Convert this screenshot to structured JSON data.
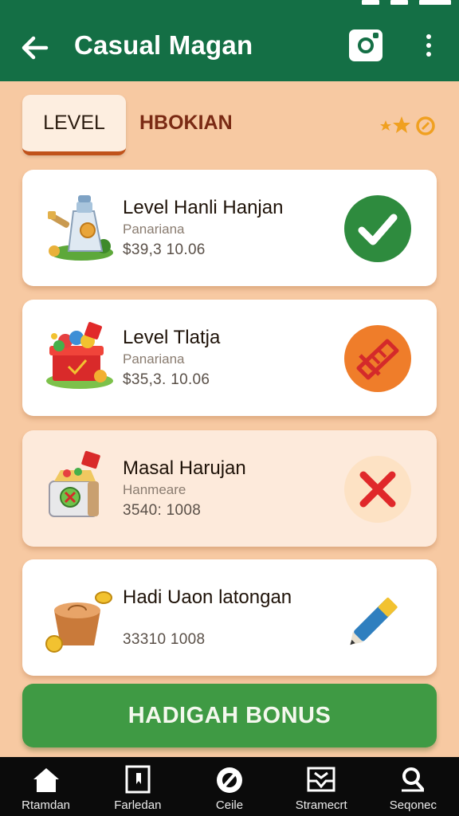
{
  "app": {
    "title": "Casual Magan",
    "accent": "#146f45",
    "background": "#f7c9a2"
  },
  "header": {
    "back_icon": "arrow-left-icon",
    "camera_icon": "camera-icon",
    "more_icon": "more-vertical-icon"
  },
  "tabs": [
    {
      "label": "LEVEL",
      "selected": true
    },
    {
      "label": "HBOKIAN",
      "selected": false
    }
  ],
  "rating_icon": "stars-badge-icon",
  "levels": [
    {
      "title": "Level Hanli Hanjan",
      "subtitle": "Panariana",
      "price": "$39,3 10.06",
      "status": "completed",
      "status_icon": "check-circle-icon",
      "status_color": "#2e8b3e",
      "image_icon": "potion-bottle-icon"
    },
    {
      "title": "Level Tlatja",
      "subtitle": "Panariana",
      "price": "$35,3. 10.06",
      "status": "in-progress",
      "status_icon": "ticket-badge-icon",
      "status_color": "#ef7d2a",
      "image_icon": "gift-box-icon"
    },
    {
      "title": "Masal Harujan",
      "subtitle": "Hanmeare",
      "price": "3540: 1008",
      "status": "failed",
      "status_icon": "x-mark-icon",
      "status_color": "#e0282a",
      "image_icon": "treasure-chest-icon"
    },
    {
      "title": "Hadi Uaon latongan",
      "subtitle": "",
      "price": "33310 1008",
      "status": "editable",
      "status_icon": "pencil-icon",
      "status_color": "#2f7fbf",
      "image_icon": "coin-pot-icon"
    }
  ],
  "bonus_button": {
    "label": "HADIGAH BONUS",
    "color": "#3f9a44"
  },
  "nav": [
    {
      "label": "Rtamdan",
      "icon": "home-icon"
    },
    {
      "label": "Farledan",
      "icon": "bookmark-card-icon"
    },
    {
      "label": "Ceile",
      "icon": "compass-icon"
    },
    {
      "label": "Stramecrt",
      "icon": "inbox-icon"
    },
    {
      "label": "Seqonec",
      "icon": "search-icon"
    }
  ]
}
